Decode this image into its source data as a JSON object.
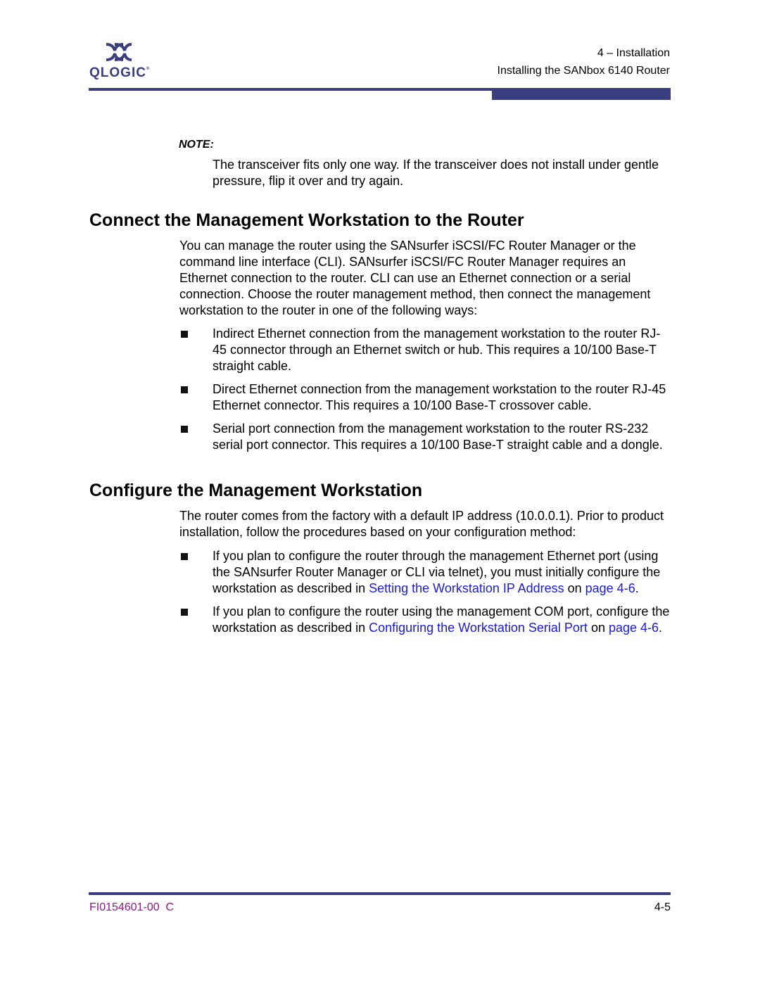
{
  "header": {
    "logo_text": "QLOGIC",
    "chapter": "4 – Installation",
    "section": "Installing the SANbox 6140 Router",
    "brand_color": "#3a3d7e"
  },
  "note": {
    "label": "NOTE:",
    "text": "The transceiver fits only one way. If the transceiver does not install under gentle pressure, flip it over and try again."
  },
  "connect_section": {
    "heading": "Connect the Management Workstation to the Router",
    "intro": "You can manage the router using the SANsurfer iSCSI/FC Router Manager or the command line interface (CLI). SANsurfer iSCSI/FC Router Manager requires an Ethernet connection to the router. CLI can use an Ethernet connection or a serial connection. Choose the router management method, then connect the management workstation to the router in one of the following ways:",
    "bullets": [
      "Indirect Ethernet connection from the management workstation to the router RJ-45 connector through an Ethernet switch or hub. This requires a 10/100 Base-T straight cable.",
      "Direct Ethernet connection from the management workstation to the router RJ-45 Ethernet connector. This requires a 10/100 Base-T crossover cable.",
      "Serial port connection from the management workstation to the router RS-232 serial port connector. This requires a 10/100 Base-T straight cable and a dongle."
    ]
  },
  "configure_section": {
    "heading": "Configure the Management Workstation",
    "intro": "The router comes from the factory with a default IP address (10.0.0.1). Prior to product installation, follow the procedures based on your configuration method:",
    "bullet1": {
      "text_before": "If you plan to configure the router through the management Ethernet port (using the SANsurfer Router Manager or CLI via telnet), you must initially configure the workstation as described in ",
      "link_title": "Setting the Workstation IP Address",
      "text_mid": " on ",
      "link_page": "page 4-6",
      "text_after": "."
    },
    "bullet2": {
      "text_before": "If you plan to configure the router using the management COM port, configure the workstation as described in ",
      "link_title": "Configuring the Workstation Serial Port",
      "text_mid": " on ",
      "link_page": "page 4-6",
      "text_after": "."
    },
    "link_color": "#1a1adf"
  },
  "footer": {
    "doc_number": "FI0154601-00  C",
    "page_number": "4-5"
  }
}
